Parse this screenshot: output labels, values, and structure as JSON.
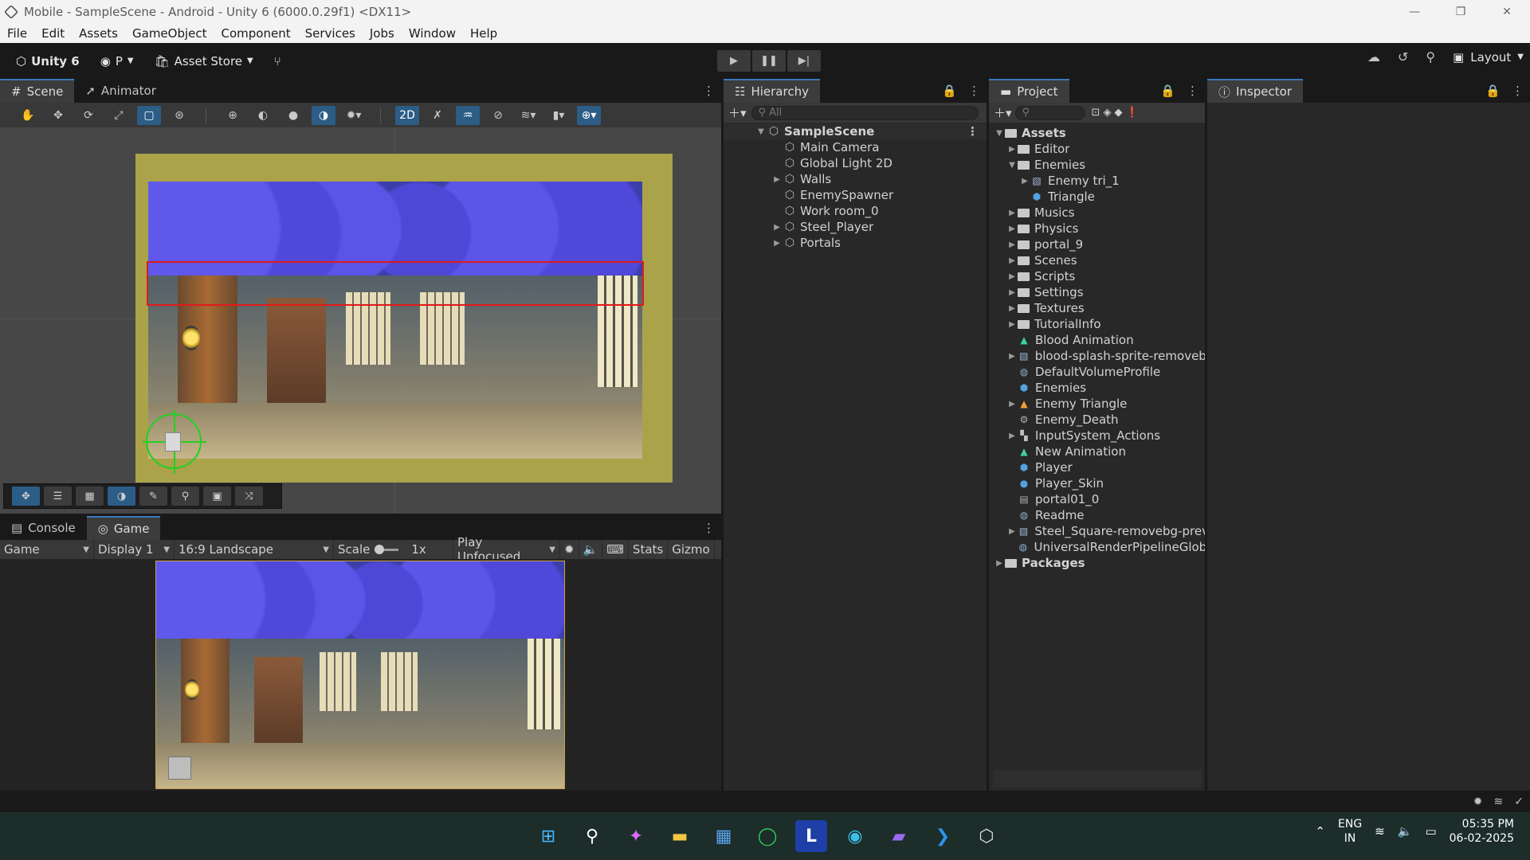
{
  "window": {
    "title": "Mobile - SampleScene - Android - Unity 6 (6000.0.29f1) <DX11>",
    "minimize": "—",
    "maximize": "❐",
    "close": "✕"
  },
  "menu": [
    "File",
    "Edit",
    "Assets",
    "GameObject",
    "Component",
    "Services",
    "Jobs",
    "Window",
    "Help"
  ],
  "toolbar": {
    "brand": "Unity 6",
    "account": "P",
    "asset_store": "Asset Store",
    "layout": "Layout"
  },
  "scene_panel": {
    "tabs": [
      "Scene",
      "Animator"
    ],
    "mode_2d": "2D"
  },
  "game_panel": {
    "tabs": [
      "Console",
      "Game"
    ],
    "view": "Game",
    "display": "Display 1",
    "aspect": "16:9 Landscape",
    "scale_label": "Scale",
    "scale_value": "1x",
    "play_mode": "Play Unfocused",
    "stats": "Stats",
    "gizmos": "Gizmo"
  },
  "hierarchy": {
    "title": "Hierarchy",
    "search_placeholder": "All",
    "scene": "SampleScene",
    "items": [
      {
        "label": "Main Camera",
        "expandable": false
      },
      {
        "label": "Global Light 2D",
        "expandable": false
      },
      {
        "label": "Walls",
        "expandable": true
      },
      {
        "label": "EnemySpawner",
        "expandable": false
      },
      {
        "label": "Work room_0",
        "expandable": false
      },
      {
        "label": "Steel_Player",
        "expandable": true
      },
      {
        "label": "Portals",
        "expandable": true
      }
    ]
  },
  "project": {
    "title": "Project",
    "root": "Assets",
    "items": [
      {
        "label": "Editor",
        "indent": 1,
        "kind": "folder",
        "arrow": "right"
      },
      {
        "label": "Enemies",
        "indent": 1,
        "kind": "folder",
        "arrow": "down"
      },
      {
        "label": "Enemy tri_1",
        "indent": 2,
        "kind": "image",
        "arrow": "right"
      },
      {
        "label": "Triangle",
        "indent": 2,
        "kind": "prefab",
        "arrow": ""
      },
      {
        "label": "Musics",
        "indent": 1,
        "kind": "folder",
        "arrow": "right"
      },
      {
        "label": "Physics",
        "indent": 1,
        "kind": "folder",
        "arrow": "right"
      },
      {
        "label": "portal_9",
        "indent": 1,
        "kind": "folder",
        "arrow": "right"
      },
      {
        "label": "Scenes",
        "indent": 1,
        "kind": "folder",
        "arrow": "right"
      },
      {
        "label": "Scripts",
        "indent": 1,
        "kind": "folder",
        "arrow": "right"
      },
      {
        "label": "Settings",
        "indent": 1,
        "kind": "folder",
        "arrow": "right"
      },
      {
        "label": "Textures",
        "indent": 1,
        "kind": "folder",
        "arrow": "right"
      },
      {
        "label": "TutorialInfo",
        "indent": 1,
        "kind": "folder",
        "arrow": "right"
      },
      {
        "label": "Blood Animation",
        "indent": 1,
        "kind": "anim",
        "arrow": ""
      },
      {
        "label": "blood-splash-sprite-removeb",
        "indent": 1,
        "kind": "image",
        "arrow": "right"
      },
      {
        "label": "DefaultVolumeProfile",
        "indent": 1,
        "kind": "asset",
        "arrow": ""
      },
      {
        "label": "Enemies",
        "indent": 1,
        "kind": "prefab",
        "arrow": ""
      },
      {
        "label": "Enemy Triangle",
        "indent": 1,
        "kind": "sprite",
        "arrow": "right"
      },
      {
        "label": "Enemy_Death",
        "indent": 1,
        "kind": "controller",
        "arrow": ""
      },
      {
        "label": "InputSystem_Actions",
        "indent": 1,
        "kind": "input",
        "arrow": "right"
      },
      {
        "label": "New Animation",
        "indent": 1,
        "kind": "anim",
        "arrow": ""
      },
      {
        "label": "Player",
        "indent": 1,
        "kind": "prefab",
        "arrow": ""
      },
      {
        "label": "Player_Skin",
        "indent": 1,
        "kind": "material",
        "arrow": ""
      },
      {
        "label": "portal01_0",
        "indent": 1,
        "kind": "doc",
        "arrow": ""
      },
      {
        "label": "Readme",
        "indent": 1,
        "kind": "asset",
        "arrow": ""
      },
      {
        "label": "Steel_Square-removebg-prev",
        "indent": 1,
        "kind": "image",
        "arrow": "right"
      },
      {
        "label": "UniversalRenderPipelineGloba",
        "indent": 1,
        "kind": "asset",
        "arrow": ""
      }
    ],
    "packages": "Packages"
  },
  "inspector": {
    "title": "Inspector"
  },
  "taskbar": {
    "lang_top": "ENG",
    "lang_bottom": "IN",
    "time": "05:35 PM",
    "date": "06-02-2025"
  },
  "colors": {
    "accent": "#3a79bb",
    "camera_bounds": "#aaa34a",
    "collider": "#e21a1a",
    "gizmo": "#23d023"
  }
}
